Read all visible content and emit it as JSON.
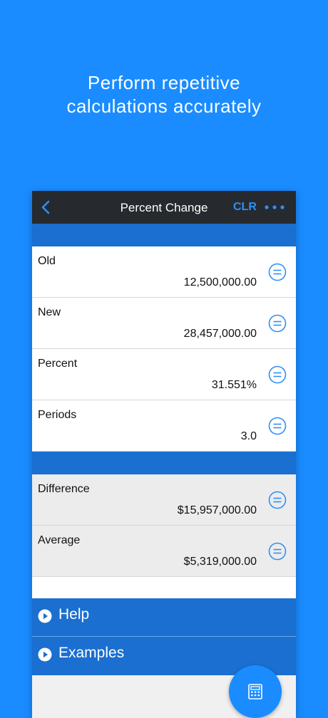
{
  "promo": {
    "line1": "Perform repetitive",
    "line2": "calculations accurately"
  },
  "navbar": {
    "back_icon": "chevron-left-icon",
    "title": "Percent Change",
    "clear_label": "CLR",
    "more_icon": "more-horizontal-icon"
  },
  "inputs": [
    {
      "label": "Old",
      "value": "12,500,000.00"
    },
    {
      "label": "New",
      "value": "28,457,000.00"
    },
    {
      "label": "Percent",
      "value": "31.551%"
    },
    {
      "label": "Periods",
      "value": "3.0"
    }
  ],
  "results": [
    {
      "label": "Difference",
      "value": "$15,957,000.00"
    },
    {
      "label": "Average",
      "value": "$5,319,000.00"
    }
  ],
  "links": {
    "help": "Help",
    "examples": "Examples"
  },
  "fab": {
    "icon": "calculator-icon"
  },
  "colors": {
    "background": "#1a8cff",
    "navbar": "#262a2f",
    "accent": "#2f8ff5",
    "band": "#1a6fd0"
  }
}
